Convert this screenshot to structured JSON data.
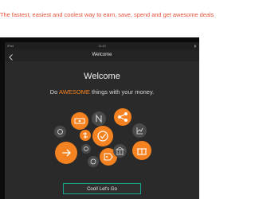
{
  "banner": {
    "text": "The fastest, easiest and coolest way to earn, save, spend and get awesome deals"
  },
  "status_bar": {
    "left": "iPad",
    "time": "11:42",
    "right": ""
  },
  "nav": {
    "title": "Welcome",
    "back_icon": "chevron-left-icon"
  },
  "welcome": {
    "title": "Welcome",
    "tagline_prefix": "Do ",
    "tagline_highlight": "AWESOME",
    "tagline_suffix": " things with your money."
  },
  "icons": [
    {
      "name": "earn-icon"
    },
    {
      "name": "network-icon"
    },
    {
      "name": "spend-icon"
    },
    {
      "name": "save-money-icon"
    },
    {
      "name": "share-icon"
    },
    {
      "name": "deals-icon"
    },
    {
      "name": "rewards-icon"
    },
    {
      "name": "growth-icon"
    },
    {
      "name": "bank-icon"
    },
    {
      "name": "send-money-icon"
    }
  ],
  "cta": {
    "label": "Cool! Let's Go"
  },
  "colors": {
    "accent": "#f58220",
    "button_border": "#16a68e",
    "banner_text": "#e8503a",
    "background": "#2a2a2a"
  }
}
